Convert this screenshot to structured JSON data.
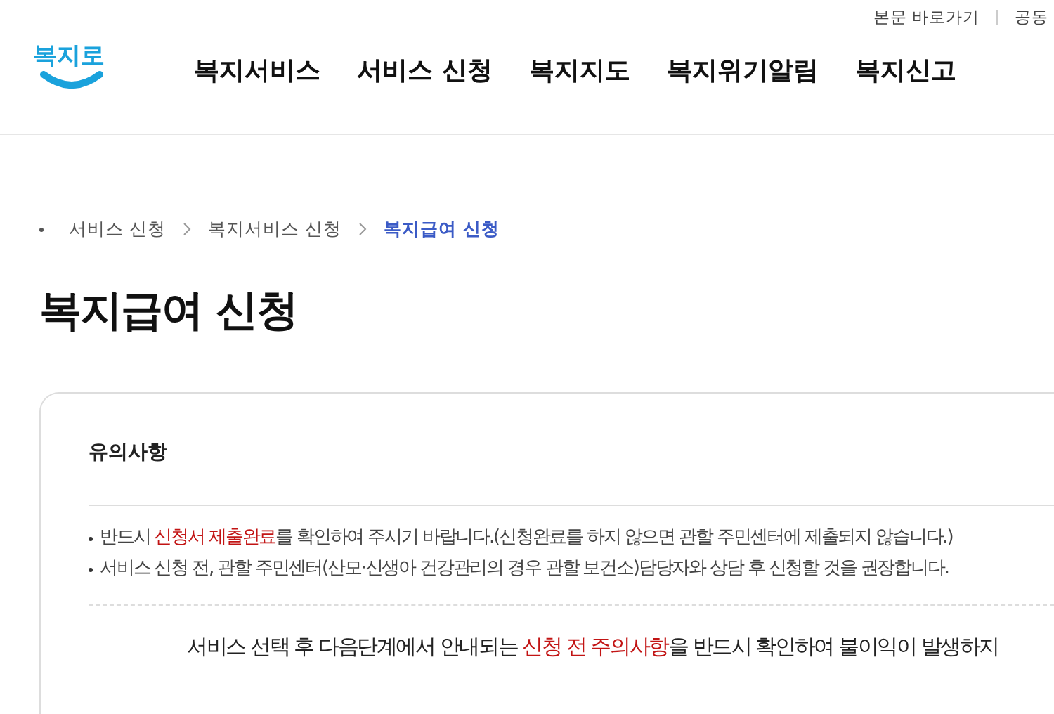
{
  "header": {
    "logo": "복지로",
    "top_links": [
      "본문 바로가기",
      "공동"
    ],
    "nav": [
      "복지서비스",
      "서비스 신청",
      "복지지도",
      "복지위기알림",
      "복지신고"
    ]
  },
  "breadcrumb": [
    {
      "label": "서비스 신청",
      "selected": false
    },
    {
      "label": "복지서비스 신청",
      "selected": false
    },
    {
      "label": "복지급여 신청",
      "selected": true
    }
  ],
  "page_title": "복지급여 신청",
  "notice": {
    "title": "유의사항",
    "bullets": [
      [
        {
          "text": "반드시 ",
          "highlight": false
        },
        {
          "text": "신청서 제출완료",
          "highlight": true
        },
        {
          "text": "를 확인하여 주시기 바랍니다.(신청완료를 하지 않으면 관할 주민센터에 제출되지 않습니다.)",
          "highlight": false
        }
      ],
      [
        {
          "text": "서비스 신청 전, 관할 주민센터(산모·신생아 건강관리의 경우 관할 보건소)담당자와 상담 후 신청할 것을 권장합니다.",
          "highlight": false
        }
      ]
    ],
    "guide": [
      {
        "text": "서비스 선택 후 다음단계에서 안내되는 ",
        "highlight": false
      },
      {
        "text": "신청 전 주의사항",
        "highlight": true
      },
      {
        "text": "을 반드시 확인하여 불이익이 발생하지",
        "highlight": false
      }
    ]
  }
}
